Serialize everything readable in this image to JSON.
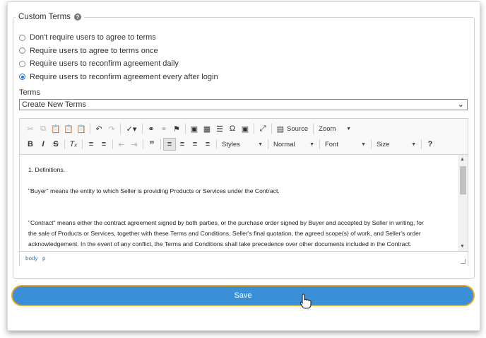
{
  "legend": "Custom Terms",
  "radios": [
    {
      "label": "Don't require users to agree to terms",
      "checked": false
    },
    {
      "label": "Require users to agree to terms once",
      "checked": false
    },
    {
      "label": "Require users to reconfirm agreement daily",
      "checked": false
    },
    {
      "label": "Require users to reconfirm agreement every after login",
      "checked": true
    }
  ],
  "terms_label": "Terms",
  "terms_select": {
    "value": "Create New Terms"
  },
  "toolbar": {
    "source_label": "Source",
    "zoom_label": "Zoom",
    "styles_label": "Styles",
    "format_label": "Normal",
    "font_label": "Font",
    "size_label": "Size",
    "help_label": "?"
  },
  "content": [
    "1. Definitions.",
    "",
    "\"Buyer\" means the entity to which Seller is providing Products or Services under the Contract.",
    "",
    "",
    "\"Contract\" means either the contract agreement signed by both parties, or the purchase order signed by Buyer and accepted by Seller in writing, for",
    "the sale of Products or Services, together with these Terms and Conditions, Seller's final quotation, the agreed scope(s) of work, and Seller's order",
    "acknowledgement. In the event of any conflict, the Terms and Conditions shall take precedence over other documents included in the Contract."
  ],
  "statusbar": {
    "path1": "body",
    "path2": "p"
  },
  "save_label": "Save"
}
